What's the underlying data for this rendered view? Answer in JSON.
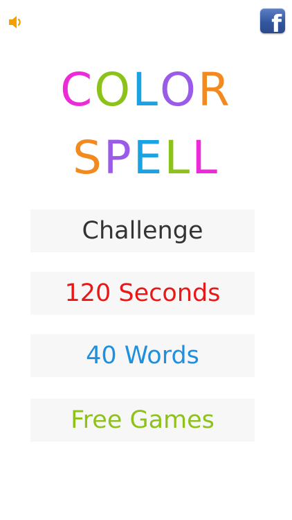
{
  "icons": {
    "sound": "speaker-icon",
    "facebook": "facebook-icon"
  },
  "facebook": {
    "glyph": "f"
  },
  "title": {
    "line1": [
      {
        "char": "C",
        "color": "#ee2ad8"
      },
      {
        "char": "O",
        "color": "#8cc21a"
      },
      {
        "char": "L",
        "color": "#1aa2e2"
      },
      {
        "char": "O",
        "color": "#9a5ce8"
      },
      {
        "char": "R",
        "color": "#f28a20"
      }
    ],
    "line2": [
      {
        "char": "S",
        "color": "#f28a20"
      },
      {
        "char": "P",
        "color": "#9a5ce8"
      },
      {
        "char": "E",
        "color": "#1aa2e2"
      },
      {
        "char": "L",
        "color": "#8cc21a"
      },
      {
        "char": "L",
        "color": "#ee2ad8"
      }
    ]
  },
  "menu": [
    {
      "label": "Challenge",
      "color": "#333333"
    },
    {
      "label": "120 Seconds",
      "color": "#e81818"
    },
    {
      "label": "40 Words",
      "color": "#1f90e0"
    },
    {
      "label": "Free Games",
      "color": "#8cc21a"
    }
  ],
  "colors": {
    "sound_icon": "#f5a000"
  }
}
